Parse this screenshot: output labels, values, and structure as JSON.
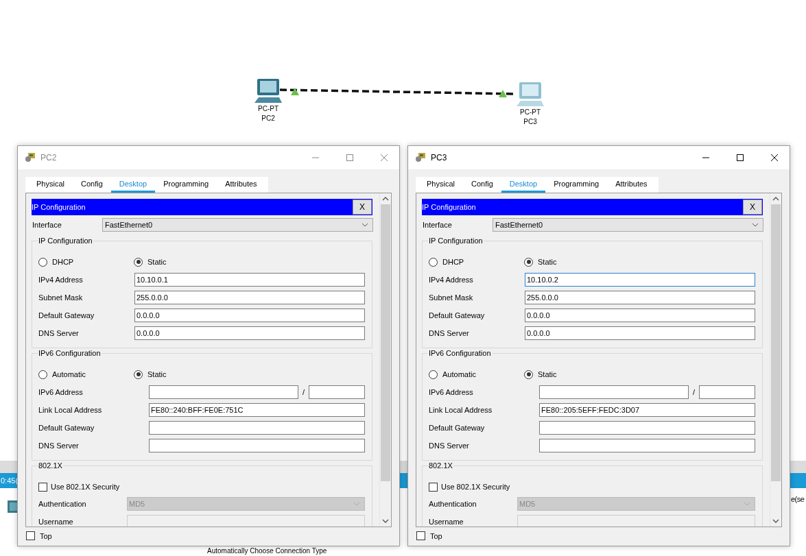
{
  "canvas": {
    "devices": [
      {
        "model": "PC-PT",
        "name": "PC2"
      },
      {
        "model": "PC-PT",
        "name": "PC3"
      }
    ]
  },
  "background": {
    "clock": "0:45(",
    "side_text": "e(se",
    "bottom_text": "Automatically Choose Connection Type"
  },
  "windows": [
    {
      "title": "PC2",
      "active": false,
      "tabs": [
        {
          "label": "Physical",
          "selected": false
        },
        {
          "label": "Config",
          "selected": false
        },
        {
          "label": "Desktop",
          "selected": true
        },
        {
          "label": "Programming",
          "selected": false
        },
        {
          "label": "Attributes",
          "selected": false
        }
      ],
      "panel_title": "IP Configuration",
      "close_label": "X",
      "interface": {
        "label": "Interface",
        "value": "FastEthernet0"
      },
      "ipv4": {
        "legend": "IP Configuration",
        "options": [
          {
            "label": "DHCP",
            "selected": false
          },
          {
            "label": "Static",
            "selected": true
          }
        ],
        "fields": [
          {
            "label": "IPv4 Address",
            "value": "10.10.0.1",
            "focused": false
          },
          {
            "label": "Subnet Mask",
            "value": "255.0.0.0",
            "focused": false
          },
          {
            "label": "Default Gateway",
            "value": "0.0.0.0",
            "focused": false
          },
          {
            "label": "DNS Server",
            "value": "0.0.0.0",
            "focused": false
          }
        ]
      },
      "ipv6": {
        "legend": "IPv6 Configuration",
        "options": [
          {
            "label": "Automatic",
            "selected": false
          },
          {
            "label": "Static",
            "selected": true
          }
        ],
        "fields": [
          {
            "label": "IPv6 Address",
            "kind": "prefixed",
            "separator": "/"
          },
          {
            "label": "Link Local Address",
            "kind": "text",
            "value": "FE80::240:BFF:FE0E:751C"
          },
          {
            "label": "Default Gateway",
            "kind": "text"
          },
          {
            "label": "DNS Server",
            "kind": "text"
          }
        ]
      },
      "dot1x": {
        "legend": "802.1X",
        "checkbox": {
          "label": "Use 802.1X Security",
          "checked": false
        },
        "fields": [
          {
            "label": "Authentication",
            "kind": "select",
            "value": "MD5"
          },
          {
            "label": "Username",
            "kind": "text"
          }
        ]
      },
      "top": {
        "label": "Top",
        "checked": false
      }
    },
    {
      "title": "PC3",
      "active": true,
      "tabs": [
        {
          "label": "Physical",
          "selected": false
        },
        {
          "label": "Config",
          "selected": false
        },
        {
          "label": "Desktop",
          "selected": true
        },
        {
          "label": "Programming",
          "selected": false
        },
        {
          "label": "Attributes",
          "selected": false
        }
      ],
      "panel_title": "IP Configuration",
      "close_label": "X",
      "interface": {
        "label": "Interface",
        "value": "FastEthernet0"
      },
      "ipv4": {
        "legend": "IP Configuration",
        "options": [
          {
            "label": "DHCP",
            "selected": false
          },
          {
            "label": "Static",
            "selected": true
          }
        ],
        "fields": [
          {
            "label": "IPv4 Address",
            "value": "10.10.0.2",
            "focused": true
          },
          {
            "label": "Subnet Mask",
            "value": "255.0.0.0",
            "focused": false
          },
          {
            "label": "Default Gateway",
            "value": "0.0.0.0",
            "focused": false
          },
          {
            "label": "DNS Server",
            "value": "0.0.0.0",
            "focused": false
          }
        ]
      },
      "ipv6": {
        "legend": "IPv6 Configuration",
        "options": [
          {
            "label": "Automatic",
            "selected": false
          },
          {
            "label": "Static",
            "selected": true
          }
        ],
        "fields": [
          {
            "label": "IPv6 Address",
            "kind": "prefixed",
            "separator": "/"
          },
          {
            "label": "Link Local Address",
            "kind": "text",
            "value": "FE80::205:5EFF:FEDC:3D07"
          },
          {
            "label": "Default Gateway",
            "kind": "text"
          },
          {
            "label": "DNS Server",
            "kind": "text"
          }
        ]
      },
      "dot1x": {
        "legend": "802.1X",
        "checkbox": {
          "label": "Use 802.1X Security",
          "checked": false
        },
        "fields": [
          {
            "label": "Authentication",
            "kind": "select",
            "value": "MD5"
          },
          {
            "label": "Username",
            "kind": "text"
          }
        ]
      },
      "top": {
        "label": "Top",
        "checked": false
      }
    }
  ]
}
